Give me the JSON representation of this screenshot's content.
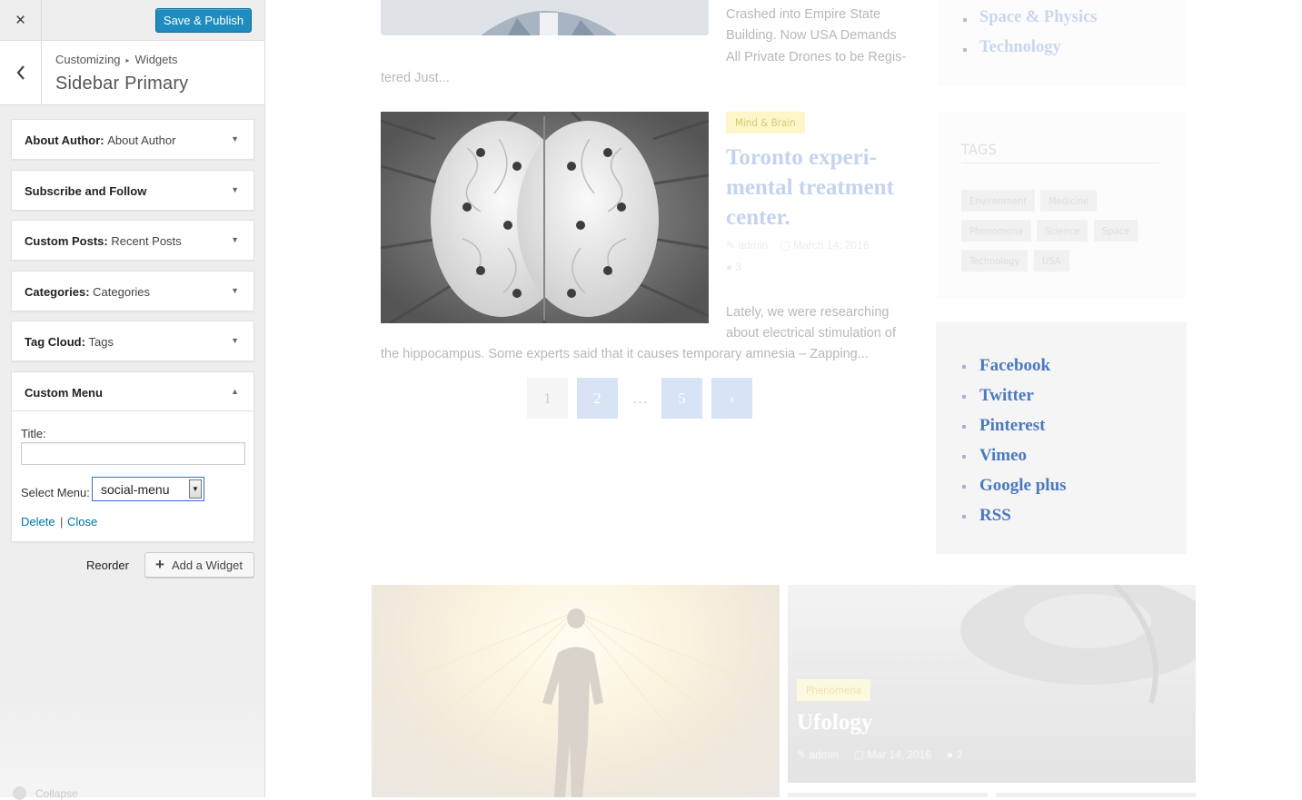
{
  "customizer": {
    "close_icon": "×",
    "save_label": "Save & Publish",
    "breadcrumb": {
      "parent": "Customizing",
      "current": "Widgets"
    },
    "panel_title": "Sidebar Primary",
    "widgets": [
      {
        "type": "About Author",
        "title": "About Author"
      },
      {
        "type": "Subscribe and Follow",
        "title": ""
      },
      {
        "type": "Custom Posts",
        "title": "Recent Posts"
      },
      {
        "type": "Categories",
        "title": "Categories"
      },
      {
        "type": "Tag Cloud",
        "title": "Tags"
      }
    ],
    "open_widget": {
      "type": "Custom Menu",
      "title_label": "Title:",
      "title_value": "",
      "select_label": "Select Menu:",
      "select_value": "social-menu",
      "delete_label": "Delete",
      "sep": "|",
      "close_label": "Close"
    },
    "reorder_label": "Reorder",
    "add_widget_label": "Add a Widget",
    "collapse_label": "Collapse"
  },
  "preview": {
    "post1_text": "Crashed into Empire State Building. Now USA Demands All Private Drones to be Regis-",
    "post1_tail": "tered Just...",
    "post2": {
      "category": "Mind & Brain",
      "title": "Toronto experi- mental treatment center.",
      "author": "admin",
      "date": "March 14, 2016",
      "comments": "3",
      "excerpt_right": "Lately, we were researching about electrical stimulation of",
      "excerpt_full": "the hippocampus. Some experts said that it causes temporary amnesia – Zapping..."
    },
    "pagination": [
      "1",
      "2",
      "…",
      "5",
      "›"
    ],
    "top_list": [
      "Space & Physics",
      "Technology"
    ],
    "tags_title": "TAGS",
    "tags": [
      "Environment",
      "Medicine",
      "Phenomena",
      "Science",
      "Space",
      "Technology",
      "USA"
    ],
    "social_menu": [
      "Facebook",
      "Twitter",
      "Pinterest",
      "Vimeo",
      "Google plus",
      "RSS"
    ],
    "ufo": {
      "category": "Phenomena",
      "title": "Ufology",
      "author": "admin",
      "date": "Mar 14, 2016",
      "comments": "2"
    }
  }
}
